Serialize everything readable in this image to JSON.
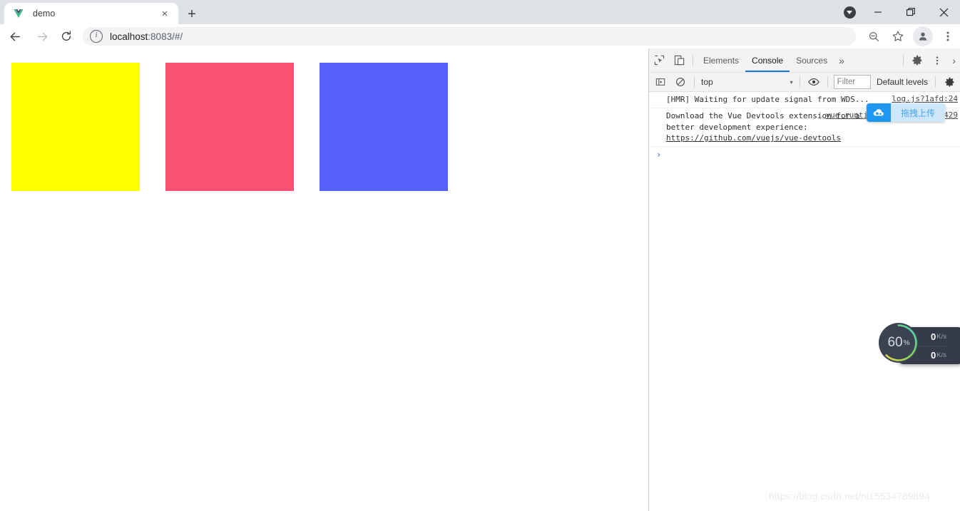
{
  "browser": {
    "tab": {
      "title": "demo",
      "favicon": "vue-logo-icon",
      "close_label": "×"
    },
    "new_tab_label": "+",
    "window_controls": {
      "download_indicator": "download-icon",
      "minimize": "—",
      "maximize": "❐",
      "close": "✕"
    },
    "nav": {
      "back": "←",
      "forward": "→",
      "reload": "↻"
    },
    "omnibox": {
      "info_glyph": "i",
      "host": "localhost",
      "path": ":8083/#/",
      "full_url": "localhost:8083/#/"
    },
    "toolbar_right": {
      "zoom_out": "zoom-out-icon",
      "bookmark": "star-icon",
      "profile": "avatar-icon",
      "menu": "three-dot-menu-icon"
    }
  },
  "page": {
    "squares": [
      {
        "name": "yellow-square",
        "color": "#FFFF00"
      },
      {
        "name": "pink-square",
        "color": "#FB5273"
      },
      {
        "name": "blue-square",
        "color": "#5561FB"
      }
    ]
  },
  "devtools": {
    "tabs": [
      {
        "label": "Elements",
        "active": false
      },
      {
        "label": "Console",
        "active": true
      },
      {
        "label": "Sources",
        "active": false
      }
    ],
    "overflow_label": "»",
    "icons": {
      "inspect": "inspect-element-icon",
      "device": "device-toolbar-icon",
      "settings": "gear-icon",
      "more": "three-dot-menu-icon",
      "close": "›",
      "sidebar": "console-sidebar-icon",
      "clear": "clear-console-icon",
      "eye": "live-expression-icon",
      "filter_settings": "console-settings-icon"
    },
    "filterbar": {
      "context": "top",
      "context_caret": "▾",
      "filter_placeholder": "Filter",
      "levels": "Default levels"
    },
    "console": {
      "messages": [
        {
          "text": "[HMR] Waiting for update signal from WDS...",
          "source": "log.js?1afd:24",
          "link": null
        },
        {
          "text": "Download the Vue Devtools extension for a better development experience: ",
          "source": "vue.runtime.esm.js?2b0e:8429",
          "link": "https://github.com/vuejs/vue-devtools"
        }
      ],
      "prompt": "›"
    }
  },
  "overlays": {
    "upload_badge": {
      "icon": "cloud-upload-icon",
      "label": "拖拽上传",
      "icon_bg": "#2096f3",
      "label_bg": "#cfe7fb"
    },
    "system_monitor": {
      "percent": "60",
      "percent_unit": "%",
      "upload": {
        "arrow": "↑",
        "value": "0",
        "unit": "K/s"
      },
      "download": {
        "arrow": "↓",
        "value": "0",
        "unit": "K/s"
      },
      "arc_colors": [
        "#4fd2c2",
        "#7fd45a",
        "#e8d44a"
      ]
    },
    "watermark": "https://blog.csdn.net/ni15534789894"
  }
}
